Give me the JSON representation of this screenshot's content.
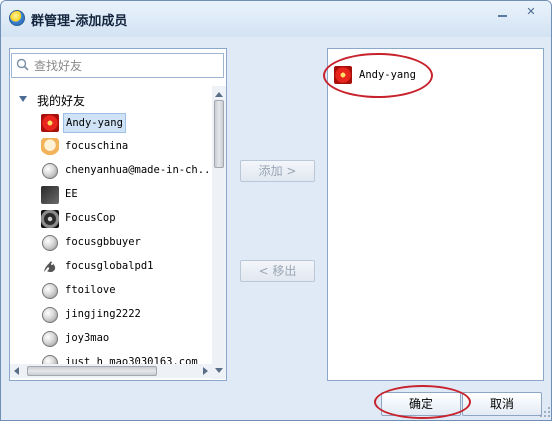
{
  "window": {
    "title": "群管理-添加成员",
    "minimize_label": "",
    "close_label": "✕"
  },
  "search": {
    "placeholder": "查找好友"
  },
  "friends_group": {
    "label": "我的好友",
    "items": [
      {
        "name": "Andy-yang",
        "avatar": "red-flower-icon",
        "selected": true
      },
      {
        "name": "focuschina",
        "avatar": "cartoon-avatar-icon",
        "selected": false
      },
      {
        "name": "chenyanhua@made-in-ch...",
        "avatar": "default-avatar-icon",
        "selected": false
      },
      {
        "name": "EE",
        "avatar": "photo-avatar-icon",
        "selected": false
      },
      {
        "name": "FocusCop",
        "avatar": "swirl-avatar-icon",
        "selected": false
      },
      {
        "name": "focusgbbuyer",
        "avatar": "default-avatar-icon",
        "selected": false
      },
      {
        "name": "focusglobalpd1",
        "avatar": "dragon-avatar-icon",
        "selected": false
      },
      {
        "name": "ftoilove",
        "avatar": "default-avatar-icon",
        "selected": false
      },
      {
        "name": "jingjing2222",
        "avatar": "default-avatar-icon",
        "selected": false
      },
      {
        "name": "joy3mao",
        "avatar": "default-avatar-icon",
        "selected": false
      },
      {
        "name": "just_h_mao3030163.com",
        "avatar": "default-avatar-icon",
        "selected": false
      }
    ]
  },
  "actions": {
    "add_label": "添加 >",
    "remove_label": "< 移出"
  },
  "members": {
    "items": [
      {
        "name": "Andy-yang",
        "avatar": "red-flower-icon"
      }
    ]
  },
  "footer": {
    "ok_label": "确定",
    "cancel_label": "取消"
  },
  "colors": {
    "highlight_oval": "#c8222c",
    "window_bg": "#dfeaf6",
    "border": "#8ba7c9"
  }
}
